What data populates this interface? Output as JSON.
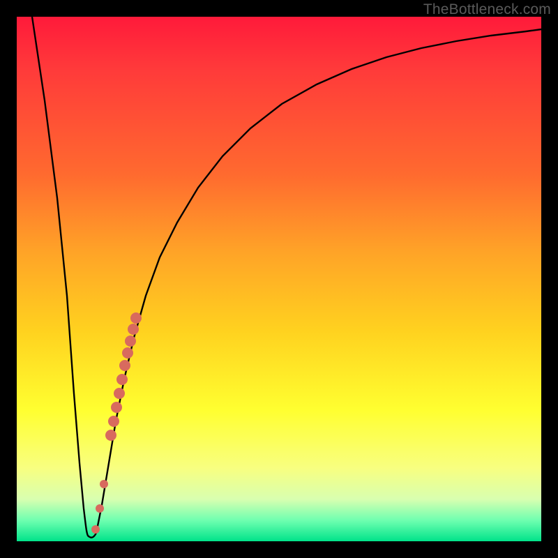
{
  "watermark": "TheBottleneck.com",
  "colors": {
    "frame": "#000000",
    "curve": "#000000",
    "marker": "#d86a5e",
    "gradient_top": "#ff1a3a",
    "gradient_bottom": "#00e38a"
  },
  "chart_data": {
    "type": "line",
    "title": "",
    "xlabel": "",
    "ylabel": "",
    "xlim": [
      0,
      100
    ],
    "ylim": [
      0,
      100
    ],
    "grid": false,
    "legend": false,
    "series": [
      {
        "name": "bottleneck-curve",
        "x": [
          0,
          3,
          6,
          8,
          10,
          11,
          12,
          13,
          14,
          16,
          18,
          20,
          22,
          25,
          28,
          32,
          36,
          40,
          45,
          50,
          55,
          60,
          65,
          70,
          75,
          80,
          85,
          90,
          95,
          100
        ],
        "y": [
          100,
          83,
          65,
          47,
          28,
          14,
          4,
          2,
          4,
          14,
          26,
          37,
          46,
          55,
          63,
          70,
          76,
          80,
          84,
          87,
          89.5,
          91.5,
          93,
          94.2,
          95.2,
          96,
          96.6,
          97.1,
          97.5,
          97.8
        ]
      }
    ],
    "markers": [
      {
        "name": "highlight-segment",
        "shape": "circle",
        "color": "#d86a5e",
        "points": [
          {
            "x": 14.0,
            "y": 3
          },
          {
            "x": 15.0,
            "y": 9
          },
          {
            "x": 16.0,
            "y": 14
          },
          {
            "x": 17.5,
            "y": 23
          },
          {
            "x": 18.0,
            "y": 26
          },
          {
            "x": 18.5,
            "y": 29
          },
          {
            "x": 19.0,
            "y": 32
          },
          {
            "x": 19.5,
            "y": 35
          },
          {
            "x": 20.0,
            "y": 37
          },
          {
            "x": 20.5,
            "y": 40
          },
          {
            "x": 21.0,
            "y": 42
          },
          {
            "x": 21.5,
            "y": 44
          },
          {
            "x": 22.0,
            "y": 46
          }
        ]
      }
    ]
  }
}
